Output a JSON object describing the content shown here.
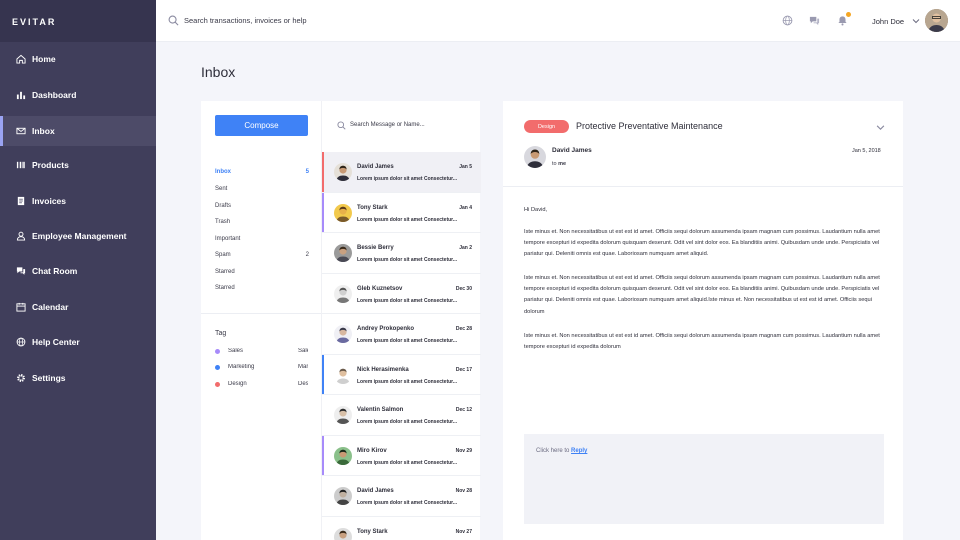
{
  "brand": "EVITAR",
  "nav": [
    {
      "label": "Home",
      "icon": "home-icon"
    },
    {
      "label": "Dashboard",
      "icon": "bar-chart-icon"
    },
    {
      "label": "Inbox",
      "icon": "mail-icon",
      "active": true
    },
    {
      "label": "Products",
      "icon": "barcode-icon"
    },
    {
      "label": "Invoices",
      "icon": "document-icon"
    },
    {
      "label": "Employee Management",
      "icon": "user-icon"
    },
    {
      "label": "Chat Room",
      "icon": "chat-icon"
    },
    {
      "label": "Calendar",
      "icon": "calendar-icon"
    },
    {
      "label": "Help Center",
      "icon": "globe-icon"
    },
    {
      "label": "Settings",
      "icon": "gear-icon"
    }
  ],
  "topbar": {
    "search_placeholder": "Search transactions, invoices or help",
    "user_name": "John Doe"
  },
  "page_title": "Inbox",
  "compose_label": "Compose",
  "folders": [
    {
      "label": "Inbox",
      "count": "5",
      "active": true
    },
    {
      "label": "Sent",
      "count": ""
    },
    {
      "label": "Drafts",
      "count": ""
    },
    {
      "label": "Trash",
      "count": ""
    },
    {
      "label": "Important",
      "count": ""
    },
    {
      "label": "Spam",
      "count": "2"
    },
    {
      "label": "Starred",
      "count": ""
    },
    {
      "label": "Starred",
      "count": ""
    }
  ],
  "tags_title": "Tag",
  "tags": [
    {
      "label": "Sales",
      "color": "#a78bfa"
    },
    {
      "label": "Marketing",
      "color": "#3f82f6"
    },
    {
      "label": "Design",
      "color": "#f26c6c"
    }
  ],
  "message_search_placeholder": "Search Message or Name...",
  "messages": [
    {
      "name": "David James",
      "date": "Jan 5",
      "preview": "Lorem ipsum dolor sit amet Consectetur...",
      "selected": true,
      "bar": "#f26c6c"
    },
    {
      "name": "Tony Stark",
      "date": "Jan 4",
      "preview": "Lorem ipsum dolor sit amet Consectetur...",
      "bar": "#a78bfa"
    },
    {
      "name": "Bessie Berry",
      "date": "Jan 2",
      "preview": "Lorem ipsum dolor sit amet Consectetur...",
      "bar": ""
    },
    {
      "name": "Gleb Kuznetsov",
      "date": "Dec 30",
      "preview": "Lorem ipsum dolor sit amet Consectetur...",
      "bar": ""
    },
    {
      "name": "Andrey Prokopenko",
      "date": "Dec 28",
      "preview": "Lorem ipsum dolor sit amet Consectetur...",
      "bar": ""
    },
    {
      "name": "Nick Herasimenka",
      "date": "Dec 17",
      "preview": "Lorem ipsum dolor sit amet Consectetur...",
      "bar": "#3f82f6"
    },
    {
      "name": "Valentin Salmon",
      "date": "Dec 12",
      "preview": "Lorem ipsum dolor sit amet Consectetur...",
      "bar": ""
    },
    {
      "name": "Miro Kirov",
      "date": "Nov 29",
      "preview": "Lorem ipsum dolor sit amet Consectetur...",
      "bar": "#a78bfa"
    },
    {
      "name": "David James",
      "date": "Nov 28",
      "preview": "Lorem ipsum dolor sit amet Consectetur...",
      "bar": ""
    },
    {
      "name": "Tony Stark",
      "date": "Nov 27",
      "preview": "Lorem ipsum dolor sit amet Consectetur...",
      "bar": ""
    }
  ],
  "detail": {
    "badge": "Design",
    "subject": "Protective Preventative Maintenance",
    "sender": "David James",
    "to_prefix": "to",
    "to": "me",
    "date": "Jan 5, 2018",
    "greeting": "Hi David,",
    "paragraphs": [
      "Iste minus et. Non necessitatibus ut est est id amet. Officiis sequi dolorum assumenda ipsam magnam cum possimus. Laudantium nulla amet tempore excepturi id expedita dolorum quisquam deserunt. Odit vel sint dolor eos. Ea blanditiis animi. Quibusdam unde unde. Perspiciatis vel pariatur qui. Deleniti omnis est quae. Laboriosam numquam amet aliquid.",
      "Iste minus et. Non necessitatibus ut est est id amet. Officiis sequi dolorum assumenda ipsam magnam cum possimus. Laudantium nulla amet tempore excepturi id expedita dolorum quisquam deserunt. Odit vel sint dolor eos. Ea blanditiis animi. Quibusdam unde unde. Perspiciatis vel pariatur qui. Deleniti omnis est quae. Laboriosam numquam amet aliquid.Iste minus et. Non necessitatibus ut est est id amet. Officiis sequi dolorum",
      "Iste minus et. Non necessitatibus ut est est id amet. Officiis sequi dolorum assumenda ipsam magnam cum possimus. Laudantium nulla amet tempore excepturi id expedita dolorum"
    ],
    "reply_prefix": "Click here to",
    "reply_link": "Reply"
  }
}
